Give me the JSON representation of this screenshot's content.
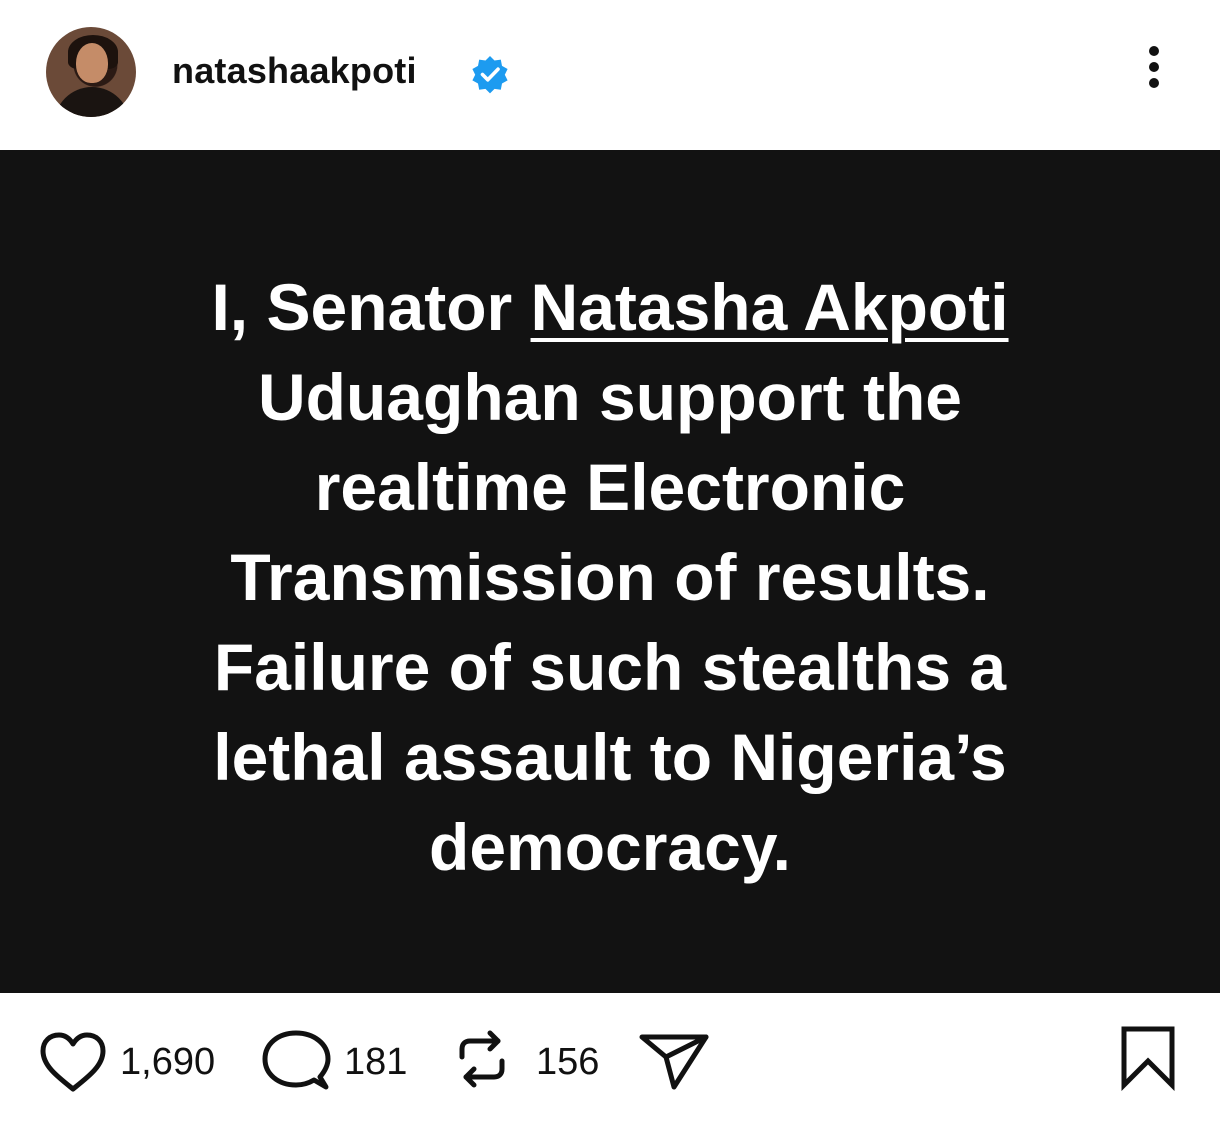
{
  "header": {
    "username": "natashaakpoti",
    "verified_color": "#1d9bf0",
    "avatar_icon": "profile-avatar",
    "more_icon": "vertical-dots-icon"
  },
  "post": {
    "background": "#121212",
    "text_color": "#ffffff",
    "lines": {
      "l1_a": "I, Senator ",
      "l1_ul": "Natasha Akpoti",
      "l2": "Uduaghan support the",
      "l3": "realtime Electronic",
      "l4": "Transmission of results.",
      "l5": "Failure of such stealths a",
      "l6": "lethal assault to Nigeria’s",
      "l7": "democracy."
    }
  },
  "actions": {
    "likes": "1,690",
    "comments": "181",
    "reposts": "156",
    "icons": [
      "heart-icon",
      "comment-icon",
      "repost-icon",
      "share-icon",
      "bookmark-icon"
    ]
  }
}
